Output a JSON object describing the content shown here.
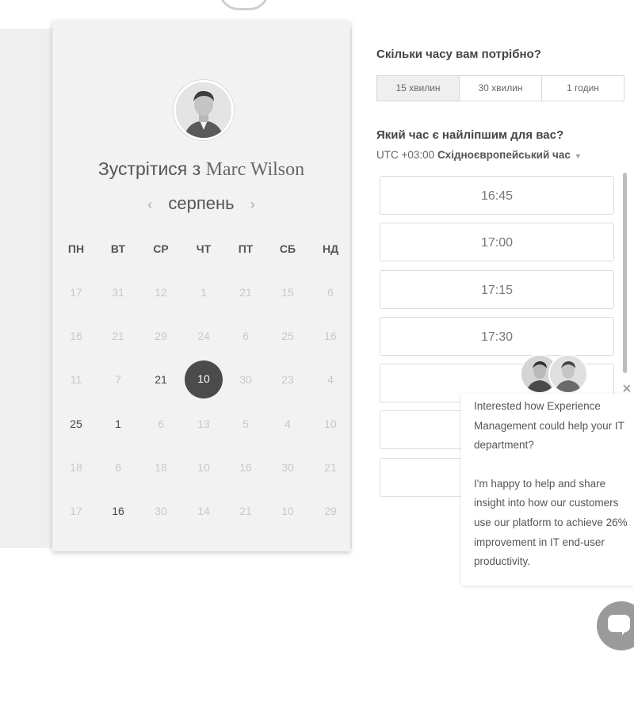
{
  "booking": {
    "title_prefix": "Зустрітися з",
    "host_name": "Marc Wilson",
    "month": "серпень",
    "prev_arrow": "‹",
    "next_arrow": "›",
    "weekdays": [
      "ПН",
      "ВТ",
      "СР",
      "ЧТ",
      "ПТ",
      "СБ",
      "НД"
    ],
    "weeks": [
      [
        "17",
        "31",
        "12",
        "1",
        "21",
        "15",
        "6"
      ],
      [
        "16",
        "21",
        "29",
        "24",
        "6",
        "25",
        "16"
      ],
      [
        "11",
        "7",
        "21",
        "10",
        "30",
        "23",
        "4"
      ],
      [
        "25",
        "1",
        "6",
        "13",
        "5",
        "4",
        "10"
      ],
      [
        "18",
        "6",
        "18",
        "10",
        "16",
        "30",
        "21"
      ],
      [
        "17",
        "16",
        "30",
        "14",
        "21",
        "10",
        "29"
      ]
    ],
    "available_days": [
      "2-2",
      "3-0",
      "3-1",
      "5-1"
    ],
    "selected_day": "10"
  },
  "duration": {
    "question": "Скільки часу вам потрібно?",
    "options": [
      "15 хвилин",
      "30 хвилин",
      "1 годин"
    ],
    "active": "15 хвилин"
  },
  "time": {
    "question": "Який час є найліпшим для вас?",
    "tz_offset": "UTC +03:00",
    "tz_name": "Східноєвропейський час",
    "slots": [
      "16:45",
      "17:00",
      "17:15",
      "17:30"
    ]
  },
  "chat_popup": {
    "paragraph1": "Interested how Experience Management could help your IT department?",
    "paragraph2": "I'm happy to help and share insight into how our customers use our platform to achieve 26% improvement in IT end-user productivity.",
    "close": "×"
  },
  "colors": {
    "selected_day_bg": "#4b4b4b",
    "chat_button": "#9a9a9a"
  },
  "icons": {
    "chat": "chat-bubble-icon",
    "close": "close-icon",
    "dropdown": "caret-down-icon"
  }
}
